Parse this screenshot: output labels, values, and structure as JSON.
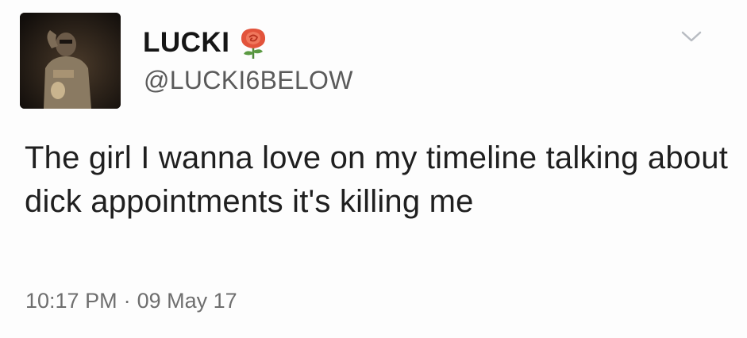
{
  "user": {
    "display_name": "LUCKI",
    "handle": "@LUCKI6BELOW",
    "emoji_icon": "rose-icon",
    "avatar_icon": "profile-photo"
  },
  "tweet": {
    "text": "The girl I wanna love on my timeline talking about dick appointments it's killing me",
    "time": "10:17 PM",
    "separator": "·",
    "date": "09 May 17"
  },
  "controls": {
    "menu_icon": "chevron-down-icon"
  },
  "colors": {
    "background": "#fdfdfd",
    "name": "#151515",
    "handle": "#5a5a5a",
    "meta": "#6e6e6e",
    "chevron": "#b8bcc2",
    "rose": "#e2533b"
  }
}
